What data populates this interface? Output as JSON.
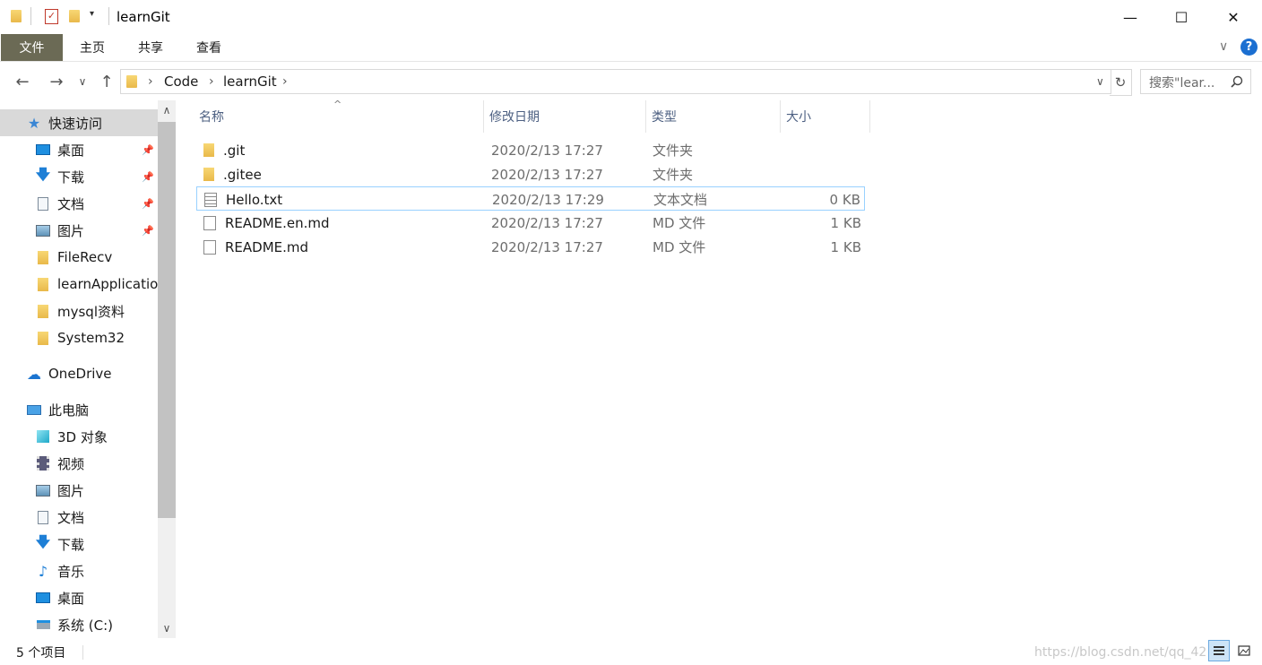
{
  "window": {
    "title": "learnGit",
    "minimize_glyph": "—",
    "maximize_glyph": "☐",
    "close_glyph": "✕"
  },
  "ribbon": {
    "tabs": [
      "文件",
      "主页",
      "共享",
      "查看"
    ],
    "file_tab_color": "#6b6a55",
    "collapse_glyph": "∨",
    "help_glyph": "?"
  },
  "nav": {
    "back_glyph": "←",
    "forward_glyph": "→",
    "recent_glyph": "∨",
    "up_glyph": "↑"
  },
  "address": {
    "crumbs": [
      "Code",
      "learnGit"
    ],
    "separator": "›",
    "dropdown_glyph": "∨",
    "refresh_glyph": "↻"
  },
  "search": {
    "placeholder": "搜索\"lear...",
    "icon": "search-icon"
  },
  "sidebar": {
    "items": [
      {
        "label": "快速访问",
        "icon": "star-icon",
        "selected": true
      },
      {
        "label": "桌面",
        "icon": "desktop-icon",
        "pinned": true
      },
      {
        "label": "下载",
        "icon": "download-icon",
        "pinned": true
      },
      {
        "label": "文档",
        "icon": "document-icon",
        "pinned": true
      },
      {
        "label": "图片",
        "icon": "picture-icon",
        "pinned": true
      },
      {
        "label": "FileRecv",
        "icon": "folder-icon"
      },
      {
        "label": "learnApplicatio",
        "icon": "folder-icon"
      },
      {
        "label": "mysql资料",
        "icon": "folder-icon"
      },
      {
        "label": "System32",
        "icon": "folder-icon"
      },
      {
        "label": "OneDrive",
        "icon": "cloud-icon"
      },
      {
        "label": "此电脑",
        "icon": "computer-icon"
      },
      {
        "label": "3D 对象",
        "icon": "cube-icon"
      },
      {
        "label": "视频",
        "icon": "video-icon"
      },
      {
        "label": "图片",
        "icon": "picture-icon"
      },
      {
        "label": "文档",
        "icon": "document-icon"
      },
      {
        "label": "下载",
        "icon": "download-icon"
      },
      {
        "label": "音乐",
        "icon": "music-icon"
      },
      {
        "label": "桌面",
        "icon": "desktop-icon"
      },
      {
        "label": "系统 (C:)",
        "icon": "drive-icon"
      }
    ],
    "pin_glyph": "📌",
    "scroll_up_glyph": "∧",
    "scroll_down_glyph": "∨"
  },
  "filelist": {
    "columns": [
      "名称",
      "修改日期",
      "类型",
      "大小"
    ],
    "sort_glyph": "^",
    "rows": [
      {
        "name": ".git",
        "date": "2020/2/13 17:27",
        "type": "文件夹",
        "size": "",
        "icon": "folder-icon"
      },
      {
        "name": ".gitee",
        "date": "2020/2/13 17:27",
        "type": "文件夹",
        "size": "",
        "icon": "folder-icon"
      },
      {
        "name": "Hello.txt",
        "date": "2020/2/13 17:29",
        "type": "文本文档",
        "size": "0 KB",
        "icon": "text-file-icon",
        "focused": true
      },
      {
        "name": "README.en.md",
        "date": "2020/2/13 17:27",
        "type": "MD 文件",
        "size": "1 KB",
        "icon": "file-icon"
      },
      {
        "name": "README.md",
        "date": "2020/2/13 17:27",
        "type": "MD 文件",
        "size": "1 KB",
        "icon": "file-icon"
      }
    ]
  },
  "status": {
    "item_count": "5 个项目",
    "watermark": "https://blog.csdn.net/qq_42"
  }
}
